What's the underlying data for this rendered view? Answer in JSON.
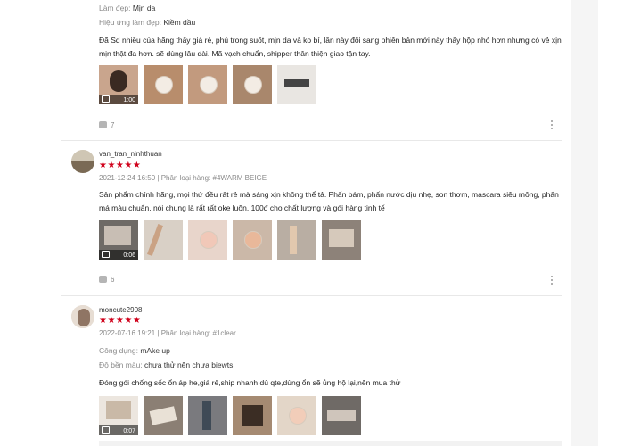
{
  "reviews": [
    {
      "attributes": [
        {
          "key": "Làm đẹp:",
          "value": "Mịn da"
        },
        {
          "key": "Hiệu ứng làm đẹp:",
          "value": "Kiềm dầu"
        }
      ],
      "content": "Đã Sd nhiều của hãng thấy giá rẻ, phủ trong suốt, mịn da và ko bí, lần này đổi sang phiên bản mới này thấy hộp nhỏ hơn nhưng có vẻ xịn mịn thật đa hơn. sẽ dùng lâu dài. Mã vạch chuẩn, shipper thân thiện giao tận tay.",
      "video_duration": "1:00",
      "likes": "7"
    },
    {
      "username": "van_tran_ninhthuan",
      "stars": "★★★★★",
      "meta": "2021-12-24 16:50 | Phân loại hàng: #4WARM BEIGE",
      "content": "Sản phẩm chính hãng, mọi thứ đều rất rẻ mà sáng xịn không thể tả. Phấn bám, phấn nước dịu nhẹ, son thơm, mascara siêu mông, phấn má màu chuẩn,  nói chung là rất rất oke luôn.  100đ cho chất lượng và gói hàng tinh tế",
      "video_duration": "0:06",
      "likes": "6"
    },
    {
      "username": "moncute2908",
      "stars": "★★★★★",
      "meta": "2022-07-16 19:21 | Phân loại hàng: #1clear",
      "attributes": [
        {
          "key": "Công dụng:",
          "value": "mAke up"
        },
        {
          "key": "Độ bền màu:",
          "value": "chưa thử nên chưa biewts"
        }
      ],
      "content": "Đóng gói chống sốc ổn áp he,giá rẻ,ship nhanh dù qte,dùng ổn sẽ ủng hộ lại,nên mua thử",
      "video_duration": "0:07"
    }
  ]
}
